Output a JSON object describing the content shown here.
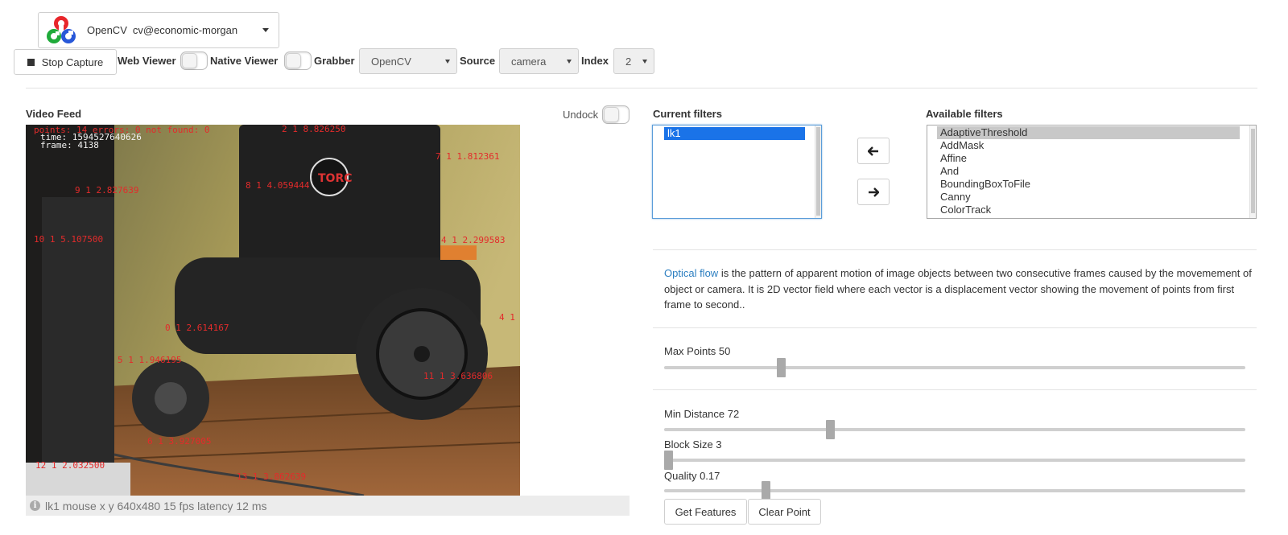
{
  "service": {
    "name": "OpenCV",
    "user": "cv@economic-morgan"
  },
  "toolbar": {
    "stop_label": "Stop Capture",
    "web_viewer_label": "Web Viewer",
    "native_viewer_label": "Native Viewer",
    "grabber_label": "Grabber",
    "grabber_value": "OpenCV",
    "source_label": "Source",
    "source_value": "camera",
    "index_label": "Index",
    "index_value": "2"
  },
  "video": {
    "title": "Video Feed",
    "undock_label": "Undock",
    "overlay": {
      "line1": "points: 14 errors: 0 not found: 0",
      "line2": "time: 1594527640626",
      "line3": "frame: 4138"
    },
    "points": [
      "2 1 8.826250",
      "7 1 1.812361",
      "9 1 2.827639",
      "8 1 4.059444",
      "10 1 5.107500",
      "4 1 2.299583",
      "4 1",
      "0 1 2.614167",
      "5 1 1.946195",
      "11 1 3.636806",
      "6 1 3.927005",
      "12 1 2.032500",
      "13 1 3.862639"
    ],
    "status": "lk1 mouse x y 640x480 15 fps latency 12 ms"
  },
  "filters": {
    "current_label": "Current filters",
    "current": [
      "lk1"
    ],
    "available_label": "Available filters",
    "available": [
      "AdaptiveThreshold",
      "AddMask",
      "Affine",
      "And",
      "BoundingBoxToFile",
      "Canny",
      "ColorTrack"
    ]
  },
  "description": {
    "link_text": "Optical flow",
    "text": " is the pattern of apparent motion of image objects between two consecutive frames caused by the movemement of object or camera. It is 2D vector field where each vector is a displacement vector showing the movement of points from first frame to second.."
  },
  "sliders": [
    {
      "label": "Max Points 50",
      "fraction": 0.197
    },
    {
      "label": "Min Distance 72",
      "fraction": 0.283
    },
    {
      "label": "Block Size 3",
      "fraction": 0.0
    },
    {
      "label": "Quality 0.17",
      "fraction": 0.17
    }
  ],
  "buttons": {
    "get_features": "Get Features",
    "clear_point": "Clear Point"
  },
  "colors": {
    "accent": "#2d7fc1",
    "overlay_text": "#e32b2b",
    "selection": "#1a73e8"
  }
}
